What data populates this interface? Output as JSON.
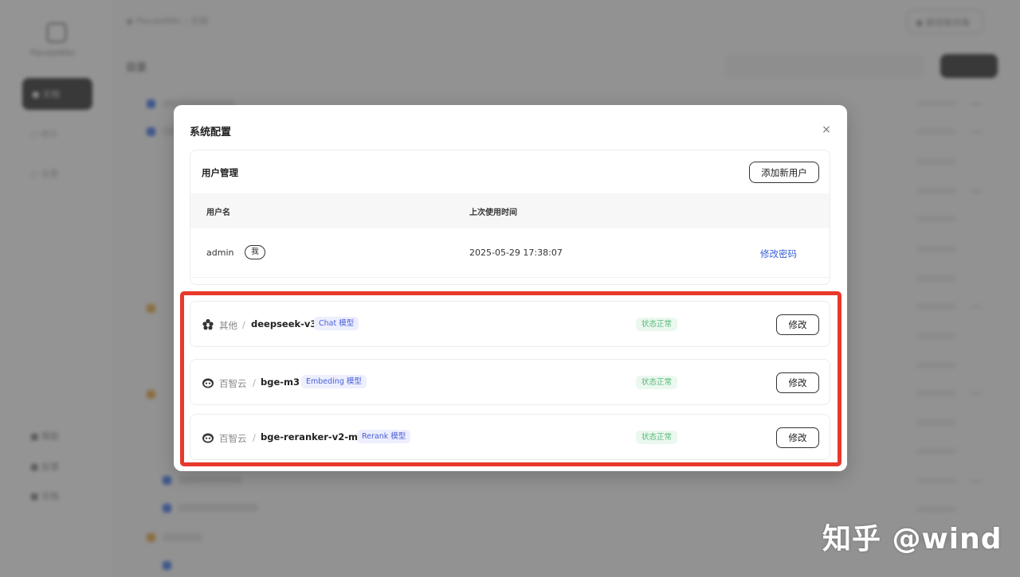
{
  "modal": {
    "title": "系统配置",
    "close_symbol": "×",
    "user_management": {
      "title": "用户管理",
      "add_user_label": "添加新用户",
      "columns": [
        "用户名",
        "上次使用时间"
      ],
      "rows": [
        {
          "username": "admin",
          "badge": "我",
          "last_used": "2025-05-29 17:38:07",
          "action": "修改密码"
        }
      ]
    },
    "models": [
      {
        "icon": "cube-cluster-icon",
        "provider": "其他",
        "name": "deepseek-v3",
        "type": "Chat 模型",
        "status": "状态正常",
        "action": "修改"
      },
      {
        "icon": "baidu-cloud-icon",
        "provider": "百智云",
        "name": "bge-m3",
        "type": "Embeding 模型",
        "status": "状态正常",
        "action": "修改"
      },
      {
        "icon": "baidu-cloud-icon",
        "provider": "百智云",
        "name": "bge-reranker-v2-m3",
        "type": "Rerank 模型",
        "status": "状态正常",
        "action": "修改"
      }
    ]
  },
  "watermark": "知乎 @wind",
  "colors": {
    "highlight": "#e8392b",
    "link": "#3b5fd6",
    "type_tag_bg": "#edeffd",
    "status_ok": "#58b87a"
  }
}
